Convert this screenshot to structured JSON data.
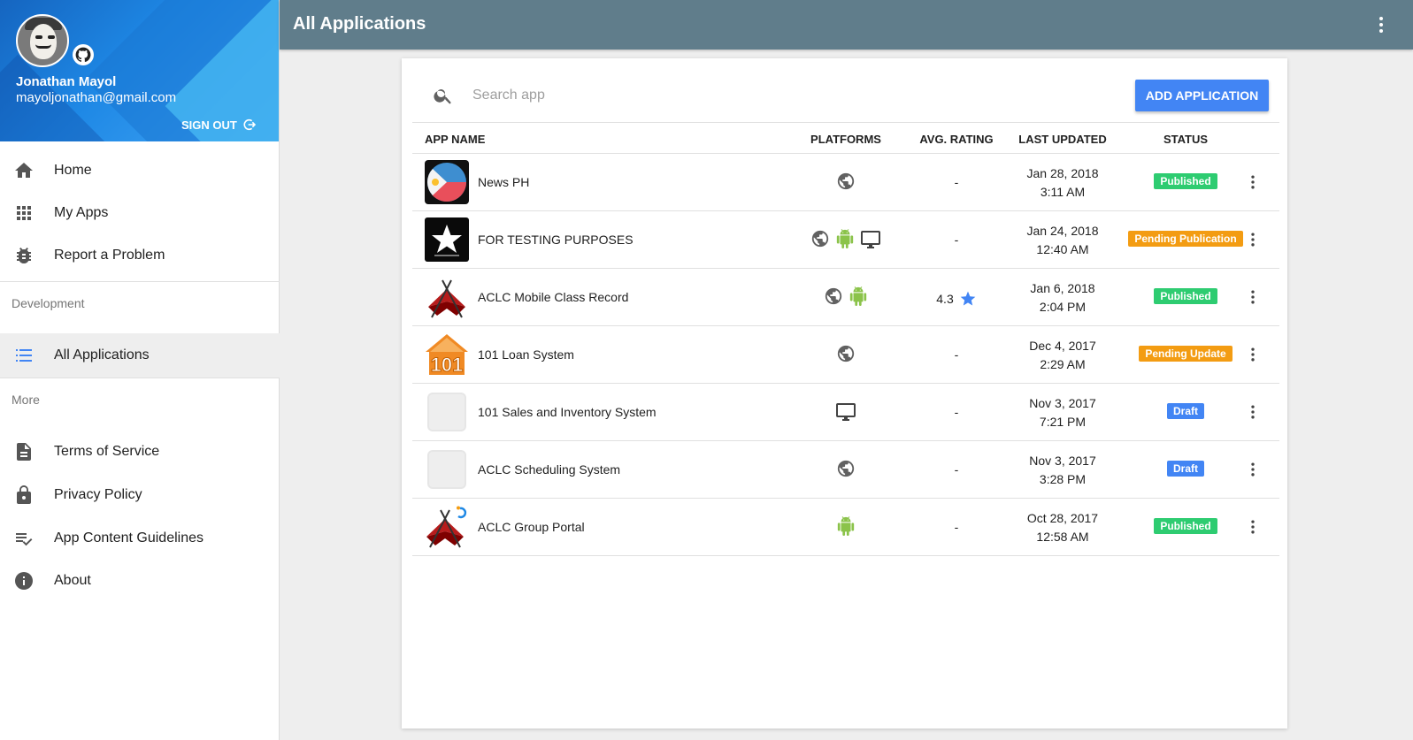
{
  "sidebar": {
    "profile": {
      "name": "Jonathan Mayol",
      "email": "mayoljonathan@gmail.com",
      "sign_out": "SIGN OUT"
    },
    "nav": [
      {
        "label": "Home",
        "icon": "home-icon"
      },
      {
        "label": "My Apps",
        "icon": "apps-grid-icon"
      },
      {
        "label": "Report a Problem",
        "icon": "bug-icon"
      }
    ],
    "development_header": "Development",
    "development_items": [
      {
        "label": "All Applications",
        "icon": "list-icon",
        "active": true
      }
    ],
    "more_header": "More",
    "more_items": [
      {
        "label": "Terms of Service",
        "icon": "document-icon"
      },
      {
        "label": "Privacy Policy",
        "icon": "lock-icon"
      },
      {
        "label": "App Content Guidelines",
        "icon": "playlist-check-icon"
      },
      {
        "label": "About",
        "icon": "info-icon"
      }
    ]
  },
  "appbar": {
    "title": "All Applications",
    "menu_icon": "more-vert-icon"
  },
  "toolbar": {
    "search_placeholder": "Search app",
    "add_button": "ADD APPLICATION"
  },
  "table": {
    "headers": {
      "name": "APP NAME",
      "platforms": "PLATFORMS",
      "rating": "AVG. RATING",
      "updated": "LAST UPDATED",
      "status": "STATUS"
    },
    "rows": [
      {
        "name": "News PH",
        "icon": "news-ph-logo",
        "platforms": [
          "web-icon"
        ],
        "rating": "-",
        "date": "Jan 28, 2018",
        "time": "3:11 AM",
        "status": "Published"
      },
      {
        "name": "FOR TESTING PURPOSES",
        "icon": "converse-logo",
        "platforms": [
          "web-icon",
          "android-icon",
          "desktop-icon"
        ],
        "rating": "-",
        "date": "Jan 24, 2018",
        "time": "12:40 AM",
        "status": "Pending Publication"
      },
      {
        "name": "ACLC Mobile Class Record",
        "icon": "aclc-logo",
        "platforms": [
          "web-icon",
          "android-icon"
        ],
        "rating": "4.3",
        "date": "Jan 6, 2018",
        "time": "2:04 PM",
        "status": "Published"
      },
      {
        "name": "101 Loan System",
        "icon": "house-101-logo",
        "platforms": [
          "web-icon"
        ],
        "rating": "-",
        "date": "Dec 4, 2017",
        "time": "2:29 AM",
        "status": "Pending Update"
      },
      {
        "name": "101 Sales and Inventory System",
        "icon": "placeholder-logo",
        "platforms": [
          "desktop-icon"
        ],
        "rating": "-",
        "date": "Nov 3, 2017",
        "time": "7:21 PM",
        "status": "Draft"
      },
      {
        "name": "ACLC Scheduling System",
        "icon": "placeholder-logo",
        "platforms": [
          "web-icon"
        ],
        "rating": "-",
        "date": "Nov 3, 2017",
        "time": "3:28 PM",
        "status": "Draft"
      },
      {
        "name": "ACLC Group Portal",
        "icon": "aclc-group-logo",
        "platforms": [
          "android-icon"
        ],
        "rating": "-",
        "date": "Oct 28, 2017",
        "time": "12:58 AM",
        "status": "Published"
      }
    ]
  },
  "status_colors": {
    "Published": "#2ecc71",
    "Pending Publication": "#f39c12",
    "Pending Update": "#f39c12",
    "Draft": "#4285f4"
  },
  "colors": {
    "appbar": "#607d8b",
    "accent": "#4285f4",
    "android": "#8bc34a",
    "star": "#4285f4"
  }
}
